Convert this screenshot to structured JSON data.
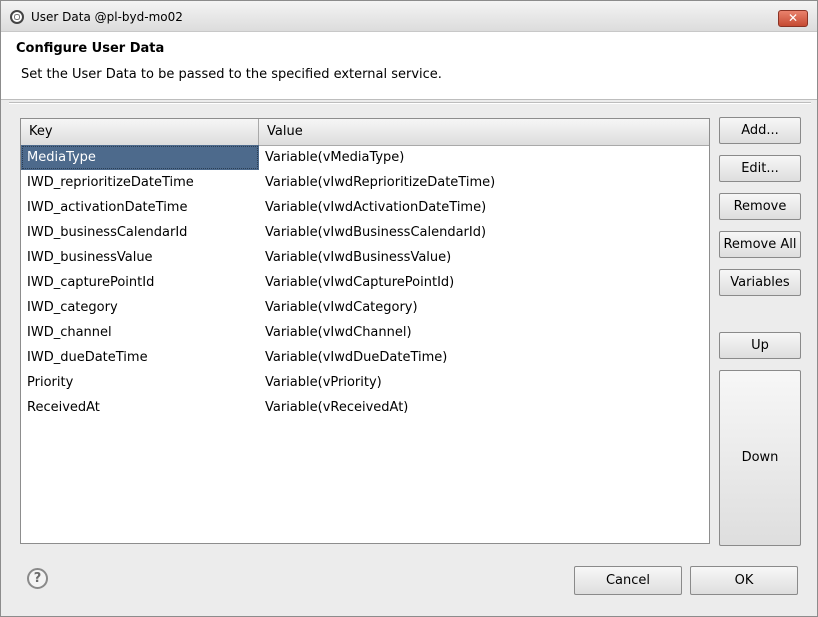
{
  "window": {
    "title": "User Data @pl-byd-mo02",
    "close_label": "✕"
  },
  "header": {
    "title": "Configure User Data",
    "description": "Set the User Data to be passed to the specified external service."
  },
  "table": {
    "columns": [
      "Key",
      "Value"
    ],
    "rows": [
      {
        "key": "MediaType",
        "value": "Variable(vMediaType)"
      },
      {
        "key": "IWD_reprioritizeDateTime",
        "value": "Variable(vIwdReprioritizeDateTime)"
      },
      {
        "key": "IWD_activationDateTime",
        "value": "Variable(vIwdActivationDateTime)"
      },
      {
        "key": "IWD_businessCalendarId",
        "value": "Variable(vIwdBusinessCalendarId)"
      },
      {
        "key": "IWD_businessValue",
        "value": "Variable(vIwdBusinessValue)"
      },
      {
        "key": "IWD_capturePointId",
        "value": "Variable(vIwdCapturePointId)"
      },
      {
        "key": "IWD_category",
        "value": "Variable(vIwdCategory)"
      },
      {
        "key": "IWD_channel",
        "value": "Variable(vIwdChannel)"
      },
      {
        "key": "IWD_dueDateTime",
        "value": "Variable(vIwdDueDateTime)"
      },
      {
        "key": "Priority",
        "value": "Variable(vPriority)"
      },
      {
        "key": "ReceivedAt",
        "value": "Variable(vReceivedAt)"
      }
    ],
    "selected_index": 0
  },
  "buttons": {
    "add": "Add...",
    "edit": "Edit...",
    "remove": "Remove",
    "remove_all": "Remove All",
    "variables": "Variables",
    "up": "Up",
    "down": "Down",
    "cancel": "Cancel",
    "ok": "OK"
  },
  "help": {
    "icon": "help-icon",
    "glyph": "?"
  },
  "colors": {
    "selection": "#4d6a8c"
  }
}
